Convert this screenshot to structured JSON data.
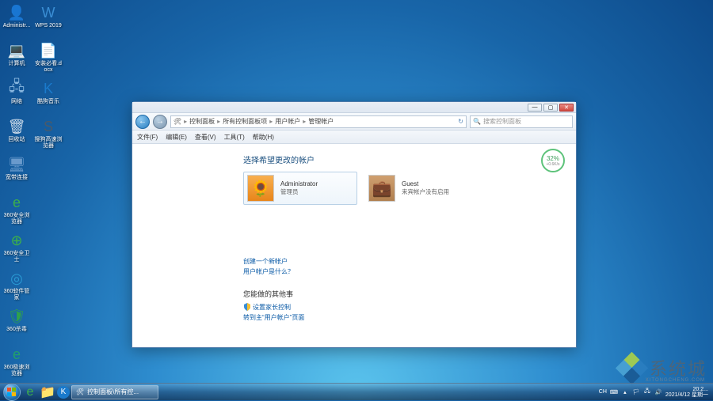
{
  "desktop_icons_col1": [
    {
      "name": "administrator",
      "label": "Administr...",
      "glyph": "👤",
      "color": "#f0c070"
    },
    {
      "name": "computer",
      "label": "计算机",
      "glyph": "💻",
      "color": "#8ab8e0"
    },
    {
      "name": "network",
      "label": "网络",
      "glyph": "🖧",
      "color": "#8ab8e0"
    },
    {
      "name": "recycle",
      "label": "回收站",
      "glyph": "🗑",
      "color": "#c8d8e8"
    },
    {
      "name": "kuandai",
      "label": "宽带连接",
      "glyph": "🖥",
      "color": "#6a9acc"
    },
    {
      "name": "360browser",
      "label": "360安全浏览器",
      "glyph": "e",
      "color": "#3cb04a"
    },
    {
      "name": "360safe",
      "label": "360安全卫士",
      "glyph": "⊕",
      "color": "#3cb04a"
    },
    {
      "name": "360soft",
      "label": "360软件管家",
      "glyph": "◎",
      "color": "#2a9ad4"
    },
    {
      "name": "360shadu",
      "label": "360杀毒",
      "glyph": "🛡",
      "color": "#2fa24a"
    },
    {
      "name": "360jisu",
      "label": "360极速浏览器",
      "glyph": "e",
      "color": "#22a06a"
    }
  ],
  "desktop_icons_col2": [
    {
      "name": "wps",
      "label": "WPS 2019",
      "glyph": "W",
      "color": "#3a8ed4"
    },
    {
      "name": "docx",
      "label": "安装必看.docx",
      "glyph": "📄",
      "color": "#e8f0f8"
    },
    {
      "name": "kugou",
      "label": "酷狗音乐",
      "glyph": "K",
      "color": "#1a7acc"
    },
    {
      "name": "sogou",
      "label": "搜狗高速浏览器",
      "glyph": "S",
      "color": "#4a5a6a"
    }
  ],
  "window": {
    "titlebar": {
      "min": "—",
      "max": "▢",
      "close": "✕"
    },
    "nav": {
      "back": "←",
      "fwd": "→"
    },
    "breadcrumb": [
      "控制面板",
      "所有控制面板项",
      "用户帐户",
      "管理帐户"
    ],
    "search_placeholder": "搜索控制面板",
    "menus": [
      "文件(F)",
      "编辑(E)",
      "查看(V)",
      "工具(T)",
      "帮助(H)"
    ],
    "heading": "选择希望更改的帐户",
    "accounts": [
      {
        "name": "Administrator",
        "sub": "管理员",
        "avatar_bg": "#e8851a"
      },
      {
        "name": "Guest",
        "sub": "来宾帐户没有启用",
        "avatar_bg": "#b08050"
      }
    ],
    "links": {
      "create": "创建一个新帐户",
      "what": "用户帐户是什么？"
    },
    "other_heading": "您能做的其他事",
    "other_links": {
      "parental": "设置家长控制",
      "goto": "转到主“用户帐户”页面"
    },
    "badge": {
      "pct": "32%",
      "speed": "+0.6K/s"
    }
  },
  "taskbar": {
    "task_label": "控制面板\\所有控...",
    "tray_text": "CH",
    "time": "20:2...",
    "date": "2021/4/12 星期一"
  },
  "watermark": {
    "text": "系统城",
    "sub": "XITONGCHENG.COM"
  }
}
